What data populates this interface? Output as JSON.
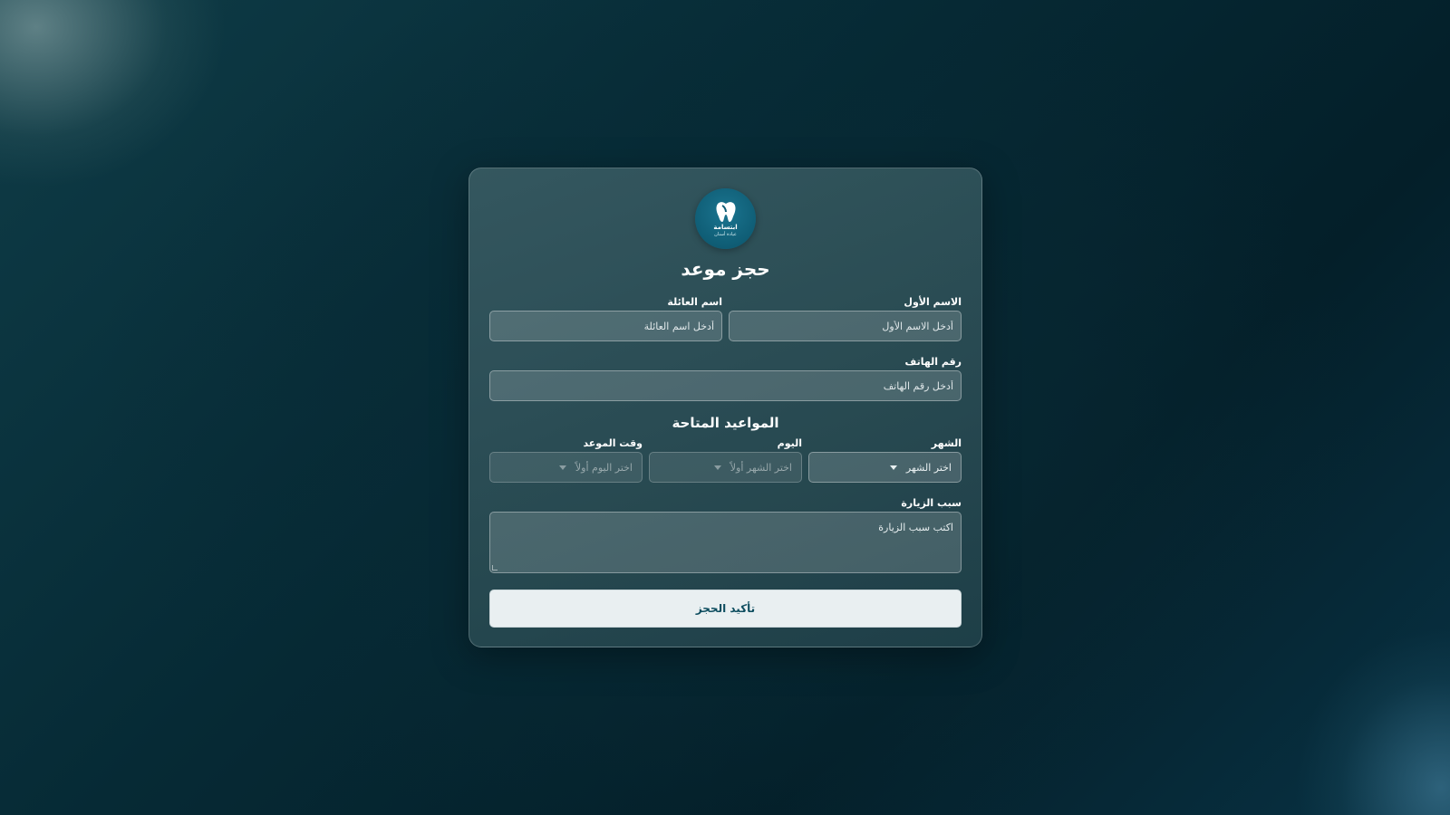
{
  "logo": {
    "brand": "ابتسامة",
    "sub": "عيادة أسنان"
  },
  "title": "حجز موعد",
  "fields": {
    "first_name": {
      "label": "الاسم الأول",
      "placeholder": "أدخل الاسم الأول"
    },
    "last_name": {
      "label": "اسم العائلة",
      "placeholder": "أدخل اسم العائلة"
    },
    "phone": {
      "label": "رقم الهاتف",
      "placeholder": "أدخل رقم الهاتف"
    }
  },
  "availability": {
    "title": "المواعيد المتاحة",
    "month": {
      "label": "الشهر",
      "value": "اختر الشهر"
    },
    "day": {
      "label": "اليوم",
      "value": "اختر الشهر أولاً"
    },
    "time": {
      "label": "وقت الموعد",
      "value": "اختر اليوم أولاً"
    }
  },
  "reason": {
    "label": "سبب الزيارة",
    "placeholder": "اكتب سبب الزيارة"
  },
  "submit_label": "تأكيد الحجز",
  "colors": {
    "accent": "#0f5d75",
    "button_bg": "#e9eff1",
    "button_text": "#0d4d5f"
  },
  "icons": {
    "logo": "tooth-icon",
    "dropdown": "chevron-down-icon"
  }
}
